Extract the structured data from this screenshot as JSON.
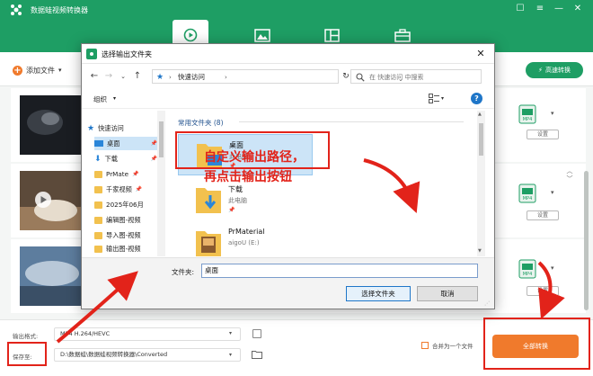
{
  "app": {
    "title": "数据蛙视频转换器",
    "nav_tabs": [
      {
        "icon": "convert-icon",
        "active": true
      },
      {
        "icon": "image-icon",
        "active": false
      },
      {
        "icon": "layout-icon",
        "active": false
      },
      {
        "icon": "toolbox-icon",
        "active": false
      }
    ],
    "window_controls": [
      "message-icon",
      "menu-icon",
      "minimize-icon",
      "close-icon"
    ],
    "toolbar": {
      "add_file_label": "添加文件",
      "hw_accel_label": "高速转换"
    },
    "rows": [
      {
        "format_badge": "MP4",
        "settings_label": "设置"
      },
      {
        "format_badge": "MP4",
        "settings_label": "设置"
      },
      {
        "format_badge": "MP4",
        "settings_label": "设置"
      }
    ],
    "bottom": {
      "output_format_label": "输出格式:",
      "output_format_value": "MP4 H.264/HEVC",
      "save_to_label": "保存至:",
      "save_path": "D:\\数据蛙\\数据蛙视频转换器\\Converted",
      "merge_label": "合并为一个文件",
      "convert_all_label": "全部转换"
    }
  },
  "dialog": {
    "title": "选择输出文件夹",
    "address": {
      "location": "快速访问"
    },
    "search_placeholder": "在 快速访问 中搜索",
    "organize_label": "组织",
    "tree": [
      {
        "label": "快速访问",
        "icon": "star-icon",
        "pinned": false
      },
      {
        "label": "桌面",
        "icon": "desktop-icon",
        "pinned": true
      },
      {
        "label": "下载",
        "icon": "download-icon",
        "pinned": true
      },
      {
        "label": "PrMate",
        "icon": "folder-icon",
        "pinned": true
      },
      {
        "label": "千家视频",
        "icon": "folder-icon",
        "pinned": true
      },
      {
        "label": "2025年06月",
        "icon": "folder-icon",
        "pinned": true
      },
      {
        "label": "编辑图-视频",
        "icon": "folder-icon",
        "pinned": true
      },
      {
        "label": "导入图-视频",
        "icon": "folder-icon",
        "pinned": true
      },
      {
        "label": "输出图-视频",
        "icon": "folder-icon",
        "pinned": true
      }
    ],
    "group_header": "常用文件夹 (8)",
    "items": [
      {
        "name": "桌面",
        "sub": "此电脑",
        "icon": "desktop-folder-icon",
        "selected": true
      },
      {
        "name": "下载",
        "sub": "此电脑",
        "icon": "download-folder-icon",
        "selected": false
      },
      {
        "name": "PrMaterial",
        "sub": "aigoU (E:)",
        "icon": "folder-icon",
        "selected": false
      }
    ],
    "folder_label": "文件夹:",
    "folder_value": "桌面",
    "select_button": "选择文件夹",
    "cancel_button": "取消"
  },
  "annotation": {
    "line1": "自定义输出路径，",
    "line2": "再点击输出按钮",
    "color": "#e2231a"
  },
  "colors": {
    "brand_green": "#1e9e64",
    "accent_orange": "#f07a2c",
    "selection_blue": "#cce4f7"
  }
}
